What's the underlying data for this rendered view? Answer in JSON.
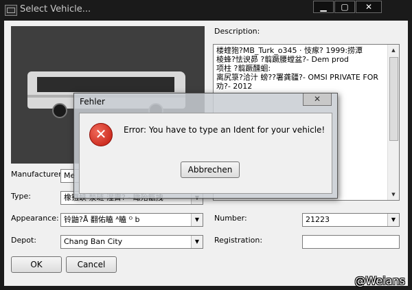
{
  "window": {
    "title": "Select Vehicle...",
    "min_label": "▁",
    "max_label": "▢",
    "close_label": "✕"
  },
  "form": {
    "description_label": "Description:",
    "description_text": "楼蝰狍?MB_Turk_o345 · 忮瘃? 1999:捞潭\n棱蜂?怯谀昴 ?翦蹶腰螳盆?- Dem prod\n项柱 ?翦蹶醺蛔:\n离尻箓?洽汁 螃??署龚疆?- OMSI PRIVATE FOR\n劝?- 2012\n\n\n\n",
    "manufacturer_label": "Manufacturer:",
    "manufacturer_value": "Me",
    "type_label": "Type:",
    "type_value": "橡镪蛱 湬琏 湦霽? - 瞰殆甑拽",
    "appearance_label": "Appearance:",
    "appearance_value": "铃鼬?Å 翻佑瞌 ᴬ瞌 ᴼ b",
    "depot_label": "Depot:",
    "depot_value": "Chang Ban City",
    "number_label": "Number:",
    "number_value": "21223",
    "registration_label": "Registration:",
    "registration_value": "",
    "ok_label": "OK",
    "cancel_label": "Cancel"
  },
  "error_dialog": {
    "title": "Fehler",
    "close_label": "✕",
    "icon": "error-icon",
    "message": "Error: You have to type an Ident for your vehicle!",
    "button_label": "Abbrechen"
  },
  "watermark": "@Weians"
}
